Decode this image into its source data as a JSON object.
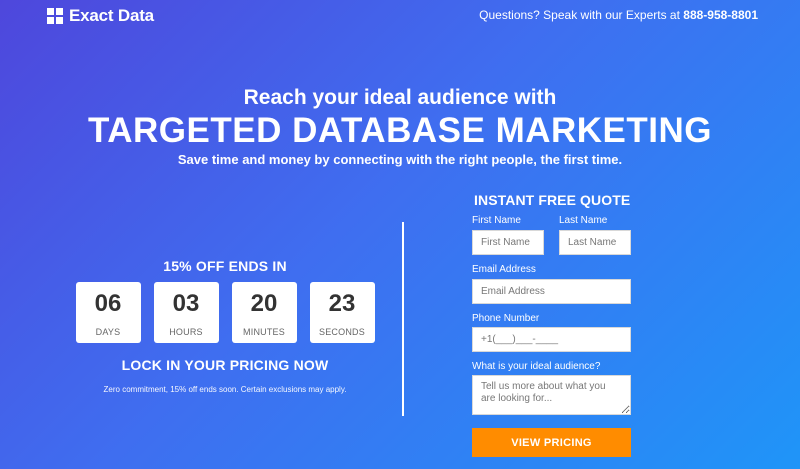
{
  "brand": {
    "name": "Exact Data"
  },
  "header": {
    "contact_prefix": "Questions? Speak with our Experts at",
    "phone": "888-958-8801"
  },
  "hero": {
    "line1": "Reach your ideal audience with",
    "line2": "TARGETED DATABASE MARKETING",
    "line3": "Save time and money by connecting with the right people, the first time."
  },
  "promo": {
    "title": "15% OFF ENDS IN",
    "countdown": [
      {
        "value": "06",
        "unit": "DAYS"
      },
      {
        "value": "03",
        "unit": "HOURS"
      },
      {
        "value": "20",
        "unit": "MINUTES"
      },
      {
        "value": "23",
        "unit": "SECONDS"
      }
    ],
    "cta_text": "LOCK IN YOUR PRICING NOW",
    "fineprint": "Zero commitment, 15% off ends soon. Certain exclusions may apply."
  },
  "form": {
    "title": "INSTANT FREE QUOTE",
    "first_name": {
      "label": "First Name",
      "placeholder": "First Name",
      "value": ""
    },
    "last_name": {
      "label": "Last Name",
      "placeholder": "Last Name",
      "value": ""
    },
    "email": {
      "label": "Email Address",
      "placeholder": "Email Address",
      "value": ""
    },
    "phone": {
      "label": "Phone Number",
      "placeholder": "+1(___)___-____",
      "value": ""
    },
    "audience": {
      "label": "What is your ideal audience?",
      "placeholder": "Tell us more about what you are looking for...",
      "value": ""
    },
    "submit_label": "VIEW PRICING"
  },
  "colors": {
    "gradient_start": "#4e47dc",
    "gradient_end": "#1f95f8",
    "cta": "#ff8c00"
  }
}
